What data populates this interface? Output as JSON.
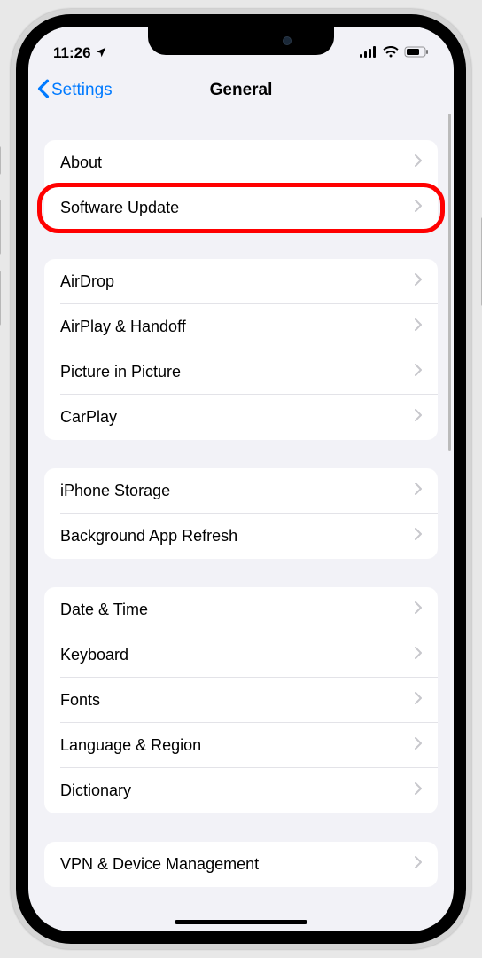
{
  "status_bar": {
    "time": "11:26",
    "location_arrow": "➤"
  },
  "nav": {
    "back_label": "Settings",
    "title": "General"
  },
  "groups": [
    {
      "rows": [
        {
          "id": "about",
          "label": "About",
          "highlighted": false
        },
        {
          "id": "software-update",
          "label": "Software Update",
          "highlighted": true
        }
      ]
    },
    {
      "rows": [
        {
          "id": "airdrop",
          "label": "AirDrop",
          "highlighted": false
        },
        {
          "id": "airplay-handoff",
          "label": "AirPlay & Handoff",
          "highlighted": false
        },
        {
          "id": "picture-in-picture",
          "label": "Picture in Picture",
          "highlighted": false
        },
        {
          "id": "carplay",
          "label": "CarPlay",
          "highlighted": false
        }
      ]
    },
    {
      "rows": [
        {
          "id": "iphone-storage",
          "label": "iPhone Storage",
          "highlighted": false
        },
        {
          "id": "background-app-refresh",
          "label": "Background App Refresh",
          "highlighted": false
        }
      ]
    },
    {
      "rows": [
        {
          "id": "date-time",
          "label": "Date & Time",
          "highlighted": false
        },
        {
          "id": "keyboard",
          "label": "Keyboard",
          "highlighted": false
        },
        {
          "id": "fonts",
          "label": "Fonts",
          "highlighted": false
        },
        {
          "id": "language-region",
          "label": "Language & Region",
          "highlighted": false
        },
        {
          "id": "dictionary",
          "label": "Dictionary",
          "highlighted": false
        }
      ]
    },
    {
      "rows": [
        {
          "id": "vpn-device-management",
          "label": "VPN & Device Management",
          "highlighted": false
        }
      ]
    }
  ]
}
